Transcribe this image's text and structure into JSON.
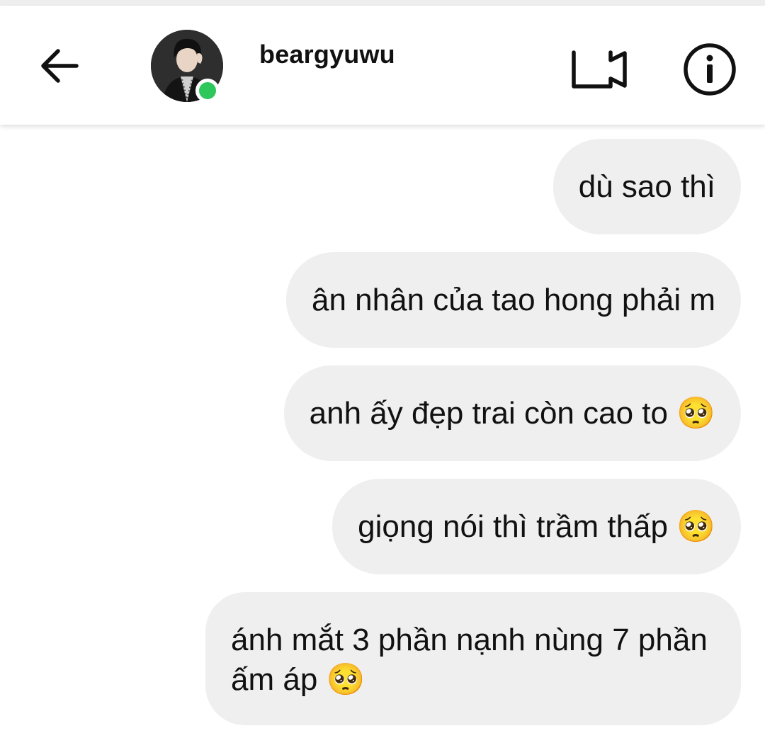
{
  "header": {
    "username": "beargyuwu",
    "online": true,
    "online_color": "#2dc75c",
    "icons": [
      "back-arrow-icon",
      "video-call-icon",
      "info-icon"
    ]
  },
  "messages": [
    {
      "text": "dù sao thì",
      "sender": "self"
    },
    {
      "text": "ân nhân của tao hong phải m",
      "sender": "self"
    },
    {
      "text": "anh ấy đẹp trai còn cao to 🥺",
      "sender": "self"
    },
    {
      "text": "giọng nói thì trầm thấp 🥺",
      "sender": "self"
    },
    {
      "text": "ánh mắt 3 phần nạnh nùng 7 phần ấm áp 🥺",
      "sender": "self"
    }
  ],
  "theme": {
    "bubble_color": "#efefef",
    "text_color": "#111111"
  }
}
